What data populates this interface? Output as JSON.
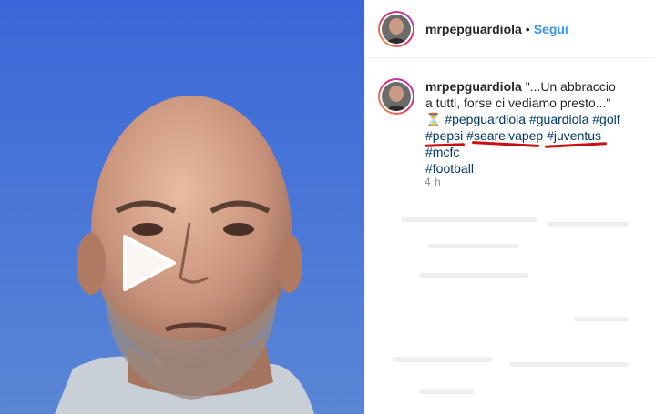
{
  "media": {
    "sky_color": "#3f6fcf",
    "play_icon": "play-icon"
  },
  "header": {
    "username": "mrpepguardiola",
    "separator": "•",
    "follow_label": "Segui"
  },
  "caption": {
    "username": "mrpepguardiola",
    "text": "\"...Un abbraccio a tutti, forse ci vediamo presto...\"",
    "hourglass": "⏳",
    "hashtags": [
      "#pepguardiola",
      "#guardiola",
      "#golf",
      "#pepsi",
      "#seareivapep",
      "#juventus",
      "#mcfc",
      "#football"
    ]
  },
  "timestamp": "4 h",
  "colors": {
    "link": "#00376b",
    "follow": "#3897f0",
    "annotation": "#c81010"
  }
}
